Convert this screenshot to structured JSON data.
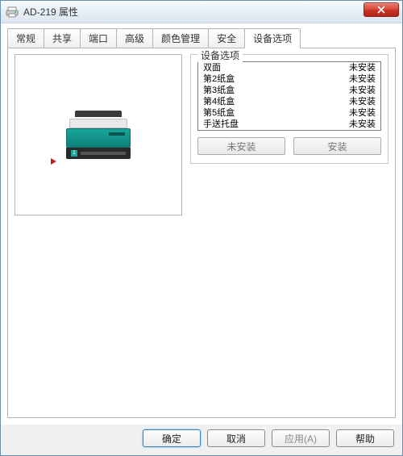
{
  "window": {
    "title": "AD-219 属性"
  },
  "tabs": [
    {
      "id": "general",
      "label": "常规"
    },
    {
      "id": "sharing",
      "label": "共享"
    },
    {
      "id": "ports",
      "label": "端口"
    },
    {
      "id": "advanced",
      "label": "高级"
    },
    {
      "id": "color",
      "label": "颜色管理"
    },
    {
      "id": "security",
      "label": "安全"
    },
    {
      "id": "device",
      "label": "设备选项",
      "active": true
    }
  ],
  "group": {
    "title": "设备选项",
    "items": [
      {
        "name": "双面",
        "status": "未安装"
      },
      {
        "name": "第2纸盒",
        "status": "未安装"
      },
      {
        "name": "第3纸盒",
        "status": "未安装"
      },
      {
        "name": "第4纸盒",
        "status": "未安装"
      },
      {
        "name": "第5纸盒",
        "status": "未安装"
      },
      {
        "name": "手送托盘",
        "status": "未安装"
      }
    ],
    "uninstall_label": "未安装",
    "install_label": "安装"
  },
  "footer": {
    "ok": "确定",
    "cancel": "取消",
    "apply": "应用(A)",
    "help": "帮助"
  }
}
